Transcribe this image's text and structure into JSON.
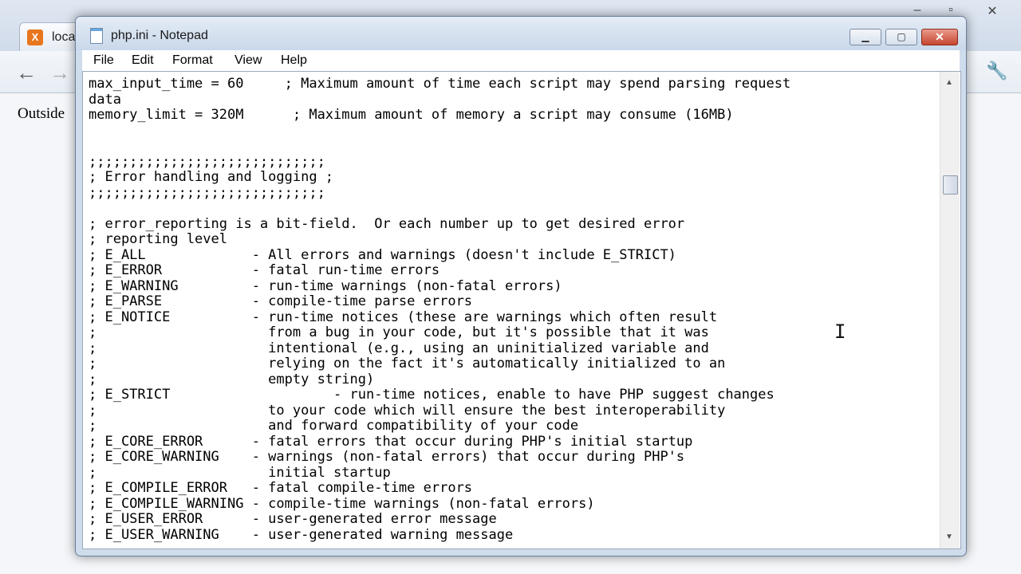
{
  "browser": {
    "tab_title": "loca",
    "tab_favicon_letter": "X",
    "back_icon": "arrow-left-icon",
    "forward_icon": "arrow-right-icon",
    "wrench_icon": "wrench-icon",
    "page_text": "Outside"
  },
  "notepad": {
    "title": "php.ini - Notepad",
    "menu": [
      "File",
      "Edit",
      "Format",
      "View",
      "Help"
    ],
    "lines": [
      "max_input_time = 60     ; Maximum amount of time each script may spend parsing request",
      "data",
      "memory_limit = 320M      ; Maximum amount of memory a script may consume (16MB)",
      "",
      "",
      ";;;;;;;;;;;;;;;;;;;;;;;;;;;;;",
      "; Error handling and logging ;",
      ";;;;;;;;;;;;;;;;;;;;;;;;;;;;;",
      "",
      "; error_reporting is a bit-field.  Or each number up to get desired error",
      "; reporting level",
      "; E_ALL             - All errors and warnings (doesn't include E_STRICT)",
      "; E_ERROR           - fatal run-time errors",
      "; E_WARNING         - run-time warnings (non-fatal errors)",
      "; E_PARSE           - compile-time parse errors",
      "; E_NOTICE          - run-time notices (these are warnings which often result",
      ";                     from a bug in your code, but it's possible that it was",
      ";                     intentional (e.g., using an uninitialized variable and",
      ";                     relying on the fact it's automatically initialized to an",
      ";                     empty string)",
      "; E_STRICT                    - run-time notices, enable to have PHP suggest changes",
      ";                     to your code which will ensure the best interoperability",
      ";                     and forward compatibility of your code",
      "; E_CORE_ERROR      - fatal errors that occur during PHP's initial startup",
      "; E_CORE_WARNING    - warnings (non-fatal errors) that occur during PHP's",
      ";                     initial startup",
      "; E_COMPILE_ERROR   - fatal compile-time errors",
      "; E_COMPILE_WARNING - compile-time warnings (non-fatal errors)",
      "; E_USER_ERROR      - user-generated error message",
      "; E_USER_WARNING    - user-generated warning message"
    ]
  }
}
